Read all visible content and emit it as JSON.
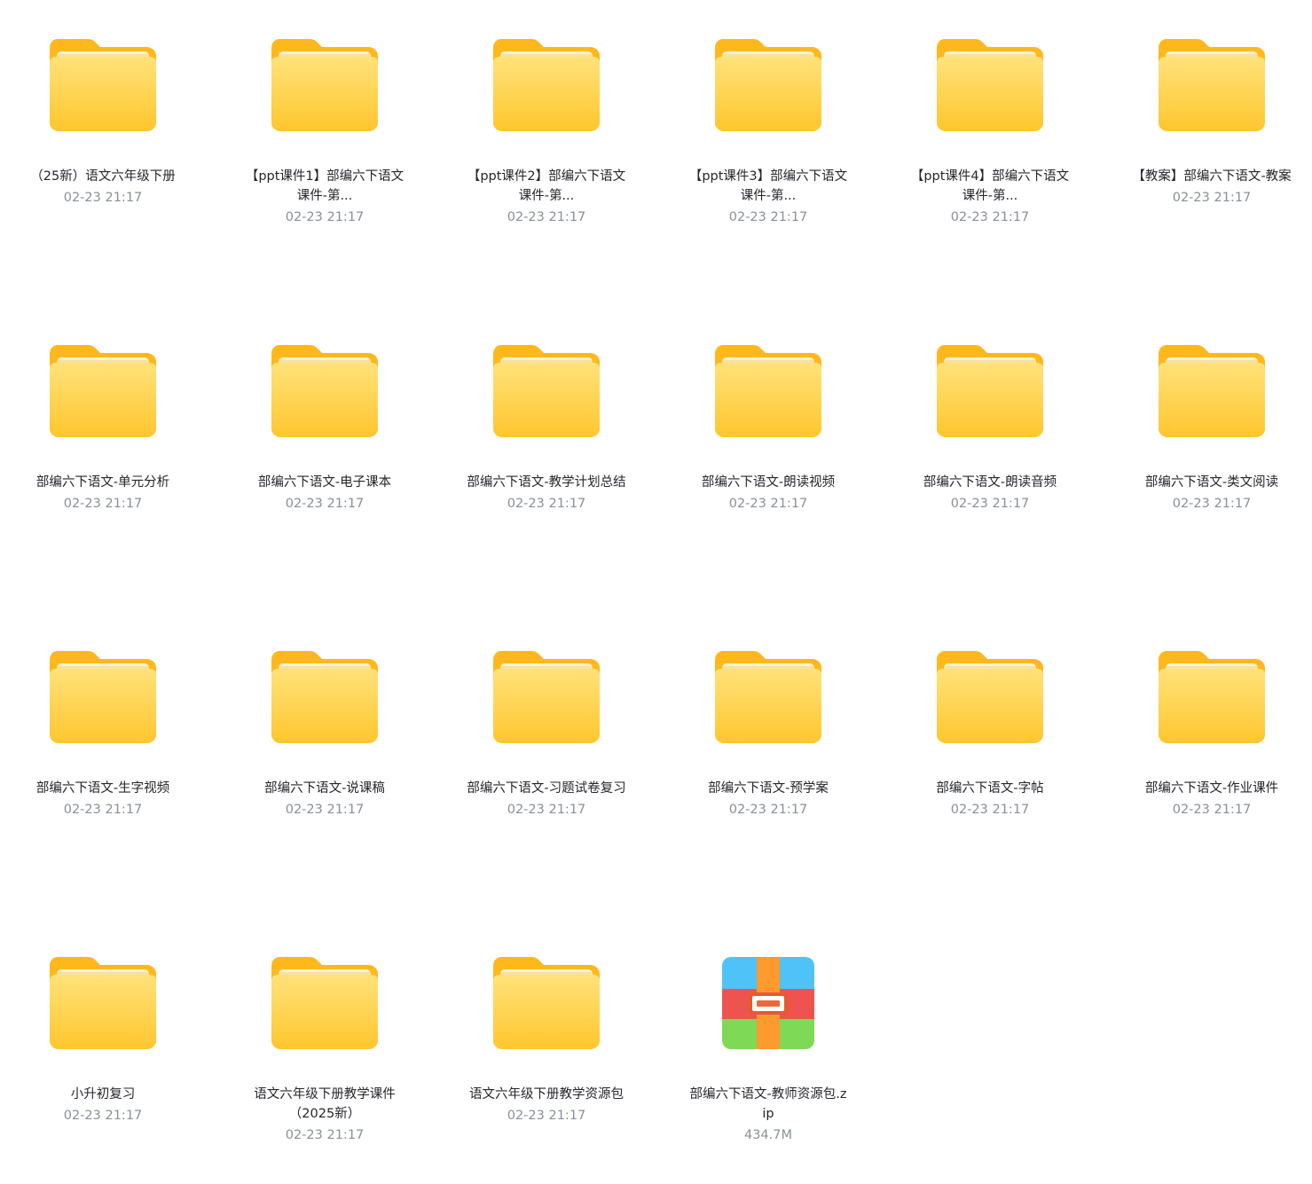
{
  "files": [
    {
      "name": "（25新）语文六年级下册",
      "meta": "02-23 21:17",
      "type": "folder"
    },
    {
      "name": "【ppt课件1】部编六下语文课件-第...",
      "meta": "02-23 21:17",
      "type": "folder"
    },
    {
      "name": "【ppt课件2】部编六下语文课件-第...",
      "meta": "02-23 21:17",
      "type": "folder"
    },
    {
      "name": "【ppt课件3】部编六下语文课件-第...",
      "meta": "02-23 21:17",
      "type": "folder"
    },
    {
      "name": "【ppt课件4】部编六下语文课件-第...",
      "meta": "02-23 21:17",
      "type": "folder"
    },
    {
      "name": "【教案】部编六下语文-教案",
      "meta": "02-23 21:17",
      "type": "folder"
    },
    {
      "name": "部编六下语文-单元分析",
      "meta": "02-23 21:17",
      "type": "folder"
    },
    {
      "name": "部编六下语文-电子课本",
      "meta": "02-23 21:17",
      "type": "folder"
    },
    {
      "name": "部编六下语文-教学计划总结",
      "meta": "02-23 21:17",
      "type": "folder"
    },
    {
      "name": "部编六下语文-朗读视频",
      "meta": "02-23 21:17",
      "type": "folder"
    },
    {
      "name": "部编六下语文-朗读音频",
      "meta": "02-23 21:17",
      "type": "folder"
    },
    {
      "name": "部编六下语文-类文阅读",
      "meta": "02-23 21:17",
      "type": "folder"
    },
    {
      "name": "部编六下语文-生字视频",
      "meta": "02-23 21:17",
      "type": "folder"
    },
    {
      "name": "部编六下语文-说课稿",
      "meta": "02-23 21:17",
      "type": "folder"
    },
    {
      "name": "部编六下语文-习题试卷复习",
      "meta": "02-23 21:17",
      "type": "folder"
    },
    {
      "name": "部编六下语文-预学案",
      "meta": "02-23 21:17",
      "type": "folder"
    },
    {
      "name": "部编六下语文-字帖",
      "meta": "02-23 21:17",
      "type": "folder"
    },
    {
      "name": "部编六下语文-作业课件",
      "meta": "02-23 21:17",
      "type": "folder"
    },
    {
      "name": "小升初复习",
      "meta": "02-23 21:17",
      "type": "folder"
    },
    {
      "name": "语文六年级下册教学课件（2025新）",
      "meta": "02-23 21:17",
      "type": "folder"
    },
    {
      "name": "语文六年级下册教学资源包",
      "meta": "02-23 21:17",
      "type": "folder"
    },
    {
      "name": "部编六下语文-教师资源包.zip",
      "meta": "434.7M",
      "type": "zip"
    }
  ],
  "icons": {
    "folder": "folder-icon",
    "zip": "zip-archive-icon"
  },
  "colors": {
    "folder_back": "#FFBE1A",
    "folder_front": "#FFD54F",
    "name_text": "#25262B",
    "meta_text": "#8A8F99",
    "zip_blue": "#4FC3F7",
    "zip_red": "#EF5350",
    "zip_green": "#7ED957",
    "zip_strap": "#FF9A2E"
  }
}
